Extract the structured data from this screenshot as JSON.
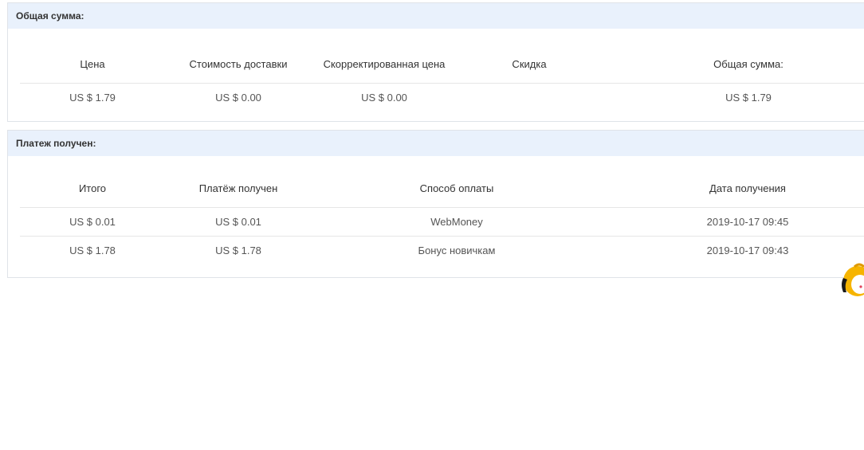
{
  "total_section": {
    "title": "Общая сумма:",
    "columns": [
      "Цена",
      "Стоимость доставки",
      "Скорректированная цена",
      "Скидка",
      "Общая сумма:"
    ],
    "rows": [
      [
        "US $ 1.79",
        "US $ 0.00",
        "US $ 0.00",
        "",
        "US $ 1.79"
      ]
    ]
  },
  "payment_section": {
    "title": "Платеж получен:",
    "columns": [
      "Итого",
      "Платёж получен",
      "Способ оплаты",
      "Дата получения"
    ],
    "rows": [
      [
        "US $ 0.01",
        "US $ 0.01",
        "WebMoney",
        "2019-10-17 09:45"
      ],
      [
        "US $ 1.78",
        "US $ 1.78",
        "Бонус новичкам",
        "2019-10-17 09:43"
      ]
    ]
  },
  "colors": {
    "header_bg": "#e9f1fc",
    "border": "#dfe3e8",
    "mascot": "#f6b400"
  },
  "icons": {
    "corner_widget": "mascot-helper-icon"
  }
}
